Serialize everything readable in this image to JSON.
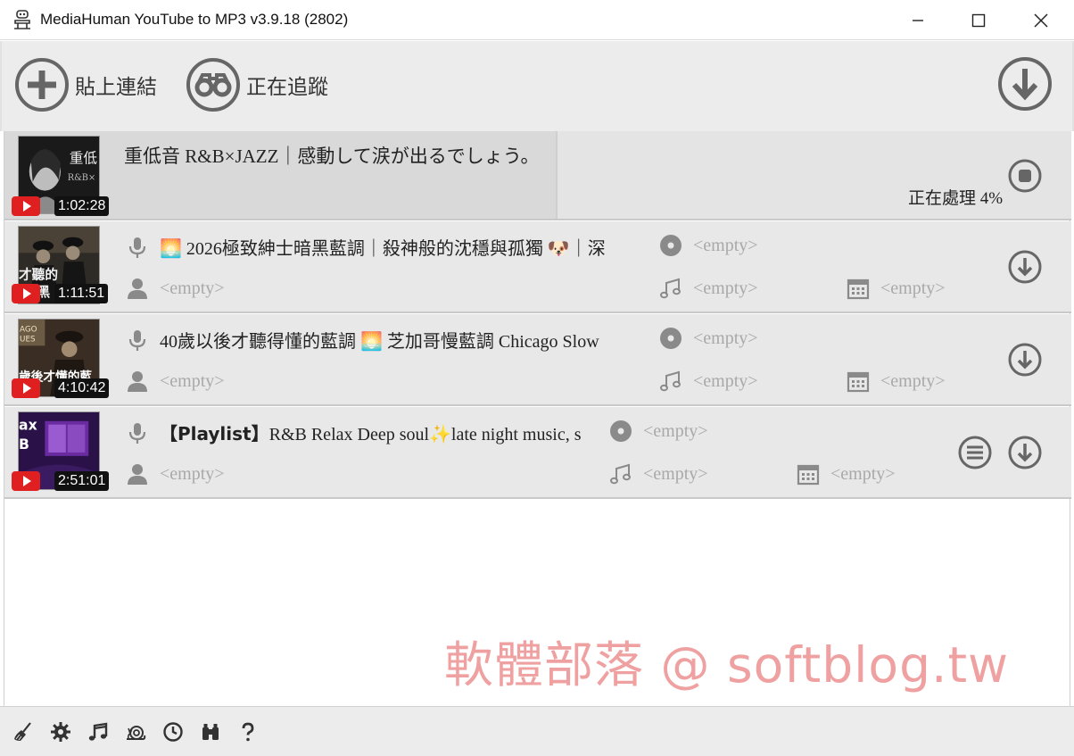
{
  "window": {
    "title": "MediaHuman YouTube to MP3 v3.9.18 (2802)"
  },
  "toolbar": {
    "paste_link_label": "貼上連結",
    "tracking_label": "正在追蹤"
  },
  "items": [
    {
      "title": "重低音 R&B×JAZZ｜感動して涙が出るでしょう。",
      "duration": "1:02:28",
      "status": "正在處理 4%",
      "progress": 0.04
    },
    {
      "title": "🌅 2026極致紳士暗黑藍調｜殺神般的沈穩與孤獨 🐶｜深",
      "duration": "1:11:51",
      "artist": "<empty>",
      "album": "<empty>",
      "genre": "<empty>",
      "year": "<empty>"
    },
    {
      "title": "40歲以後才聽得懂的藍調 🌅 芝加哥慢藍調 Chicago Slow",
      "duration": "4:10:42",
      "artist": "<empty>",
      "album": "<empty>",
      "genre": "<empty>",
      "year": "<empty>"
    },
    {
      "title_bold": "【Playlist】",
      "title_rest": "R&B Relax Deep soul✨late night music, s",
      "duration": "2:51:01",
      "artist": "<empty>",
      "album": "<empty>",
      "genre": "<empty>",
      "year": "<empty>"
    }
  ],
  "watermark": "軟體部落 @ softblog.tw",
  "colors": {
    "toolbar_bg": "#ececec",
    "row_bg": "#e8e8e8",
    "icon_gray": "#666666",
    "youtube_red": "#e02020",
    "empty_text": "#a9a9a9",
    "watermark": "#e87878"
  },
  "footer_icons": [
    "broom-icon",
    "gear-icon",
    "music-note-icon",
    "snail-icon",
    "clock-icon",
    "binoculars-icon",
    "help-icon"
  ]
}
